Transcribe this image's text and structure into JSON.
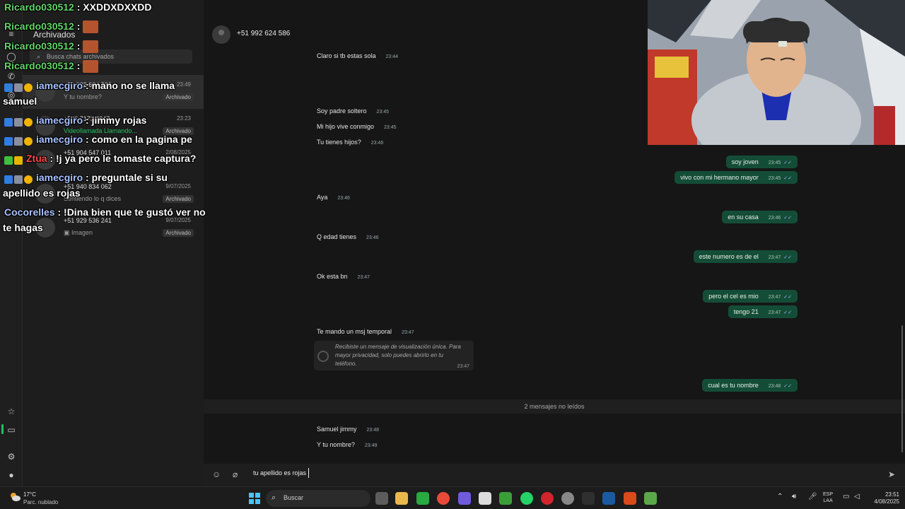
{
  "list": {
    "title": "Archivados",
    "search_placeholder": "Busca chats archivados",
    "rows": [
      {
        "name": "+51 992 624 586",
        "date": "23:49",
        "preview": "Y tu nombre?",
        "badge": "Archivado"
      },
      {
        "name": "+506 7173 4047",
        "date": "23:23",
        "preview": "Videollamada Llamando...",
        "badge": "Archivado"
      },
      {
        "name": "+51 904 547 011",
        "date": "2/08/2025",
        "preview": "",
        "badge": ""
      },
      {
        "name": "+51 940 834 062",
        "date": "9/07/2025",
        "preview": "Sentiendo lo q dices",
        "badge": "Archivado"
      },
      {
        "name": "+51 929 536 241",
        "date": "9/07/2025",
        "preview": "Imagen",
        "badge": "Archivado"
      }
    ]
  },
  "chat": {
    "contact": "+51 992 624 586",
    "messages_in": [
      {
        "text": "Claro si tb estas sola",
        "time": "23:44"
      },
      {
        "text": "Soy padre soltero",
        "time": "23:45"
      },
      {
        "text": "Mi hijo vive conmigo",
        "time": "23:45"
      },
      {
        "text": "Tu tienes hijos?",
        "time": "23:46"
      },
      {
        "text": "Aya",
        "time": "23:46"
      },
      {
        "text": "Q edad tienes",
        "time": "23:46"
      },
      {
        "text": "Ok esta bn",
        "time": "23:47"
      },
      {
        "text": "Te mando un msj temporal",
        "time": "23:47"
      },
      {
        "text": "Samuel jimmy",
        "time": "23:48"
      },
      {
        "text": "Y tu nombre?",
        "time": "23:49"
      }
    ],
    "messages_out": [
      {
        "text": "soy joven",
        "time": "23:45"
      },
      {
        "text": "vivo con mi hermano mayor",
        "time": "23:45"
      },
      {
        "text": "en su casa",
        "time": "23:46"
      },
      {
        "text": "este numero es de el",
        "time": "23:47"
      },
      {
        "text": "pero el cel es mio",
        "time": "23:47"
      },
      {
        "text": "tengo 21",
        "time": "23:47"
      },
      {
        "text": "cual es tu nombre",
        "time": "23:48"
      }
    ],
    "view_once_text": "Recibiste un mensaje de visualización única. Para mayor privacidad, solo puedes abrirlo en tu teléfono.",
    "view_once_time": "23:47",
    "unread_divider": "2 mensajes no leídos",
    "composer_value": "tu apellido es rojas"
  },
  "overlay": {
    "lines": [
      {
        "user": "Ricardo030512",
        "text": ": XXDDXDXXDD"
      },
      {
        "user": "Ricardo030512",
        "text": ":"
      },
      {
        "user": "Ricardo030512",
        "text": ":"
      },
      {
        "user": "Ricardo030512",
        "text": ":"
      },
      {
        "user": "iamecgiro",
        "text": ": mano no se llama"
      },
      {
        "user": "",
        "text": "samuel"
      },
      {
        "user": "iamecgiro",
        "text": ": jimmy rojas"
      },
      {
        "user": "iamecgiro",
        "text": ": como en la pagina pe"
      },
      {
        "user": "Ztua",
        "text": ": !j ya pero le tomaste captura?"
      },
      {
        "user": "iamecgiro",
        "text": ": preguntale si su"
      },
      {
        "user": "",
        "text": "apellido es rojas"
      },
      {
        "user": "Cocorelles",
        "text": ": !Dina bien que te gustó ver no"
      },
      {
        "user": "",
        "text": "te hagas"
      }
    ]
  },
  "taskbar": {
    "temp": "17°C",
    "condition": "Parc. nublado",
    "search": "Buscar",
    "lang_1": "ESP",
    "lang_2": "LAA",
    "time": "23:51",
    "date": "4/08/2025"
  },
  "colors": {
    "accent": "#21c063",
    "outgoing_bubble": "#144d37"
  }
}
